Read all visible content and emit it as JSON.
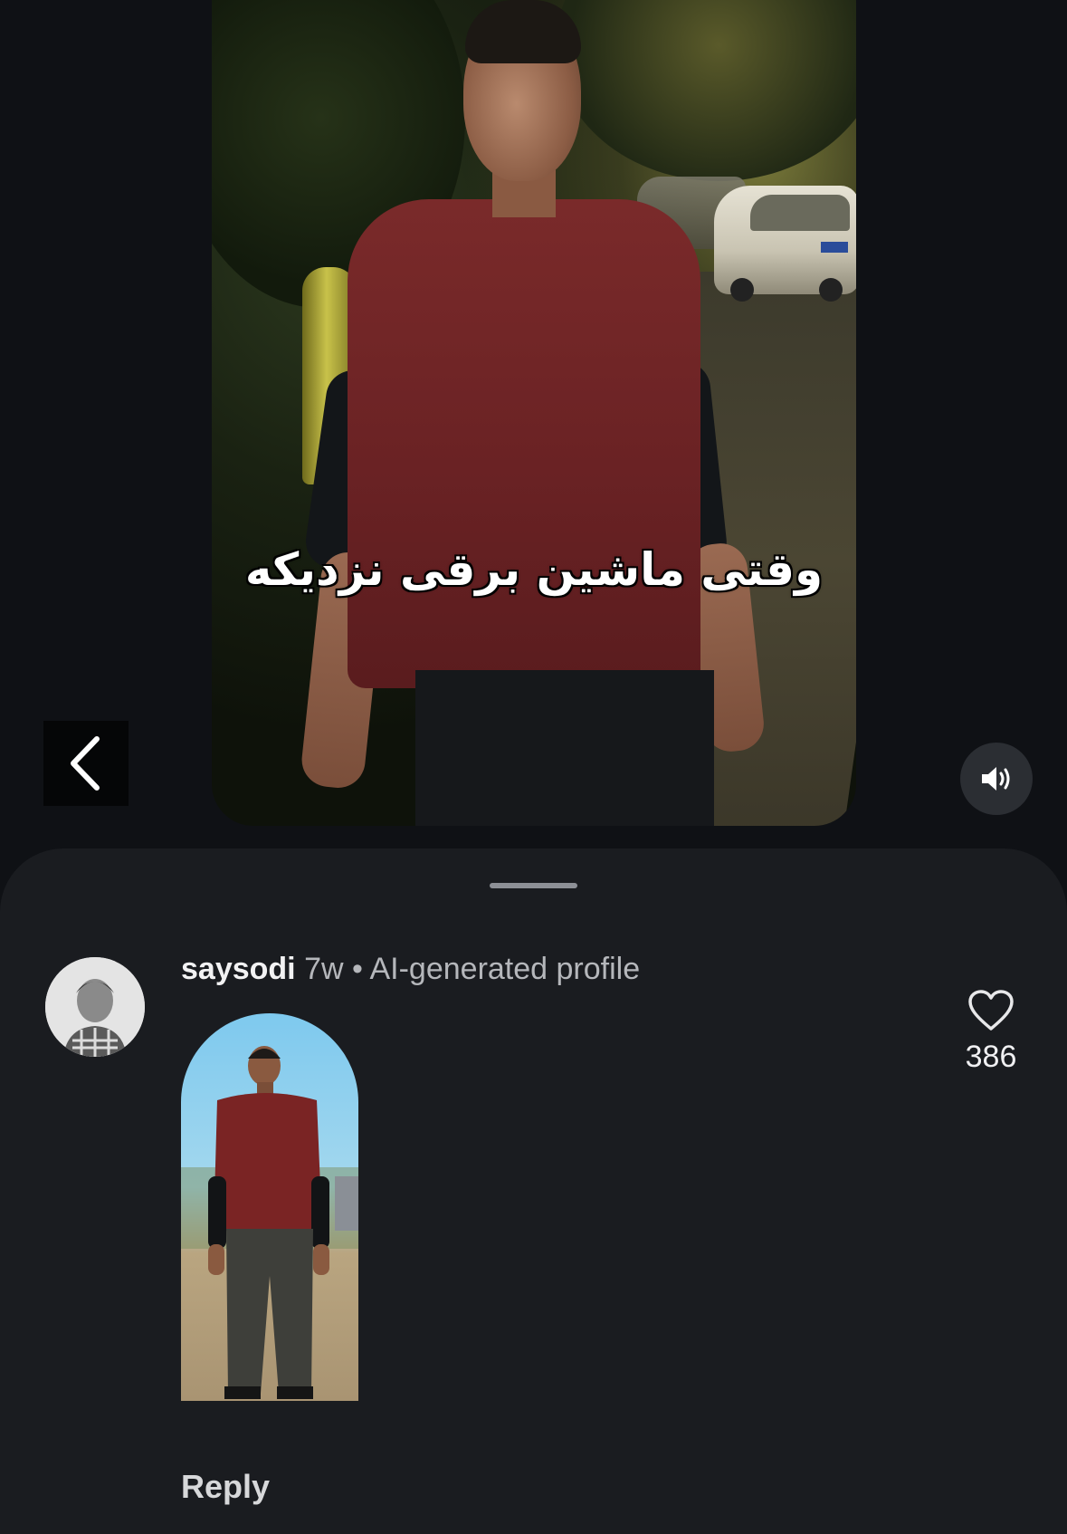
{
  "video": {
    "caption": "وقتی ماشین برقی نزدیکه"
  },
  "controls": {
    "back_icon": "chevron-left-icon",
    "volume_icon": "speaker-icon"
  },
  "comment": {
    "username": "saysodi",
    "age": "7w",
    "separator": "•",
    "profile_label": "AI-generated profile",
    "like_icon": "heart-outline-icon",
    "like_count": "386",
    "reply_label": "Reply"
  }
}
